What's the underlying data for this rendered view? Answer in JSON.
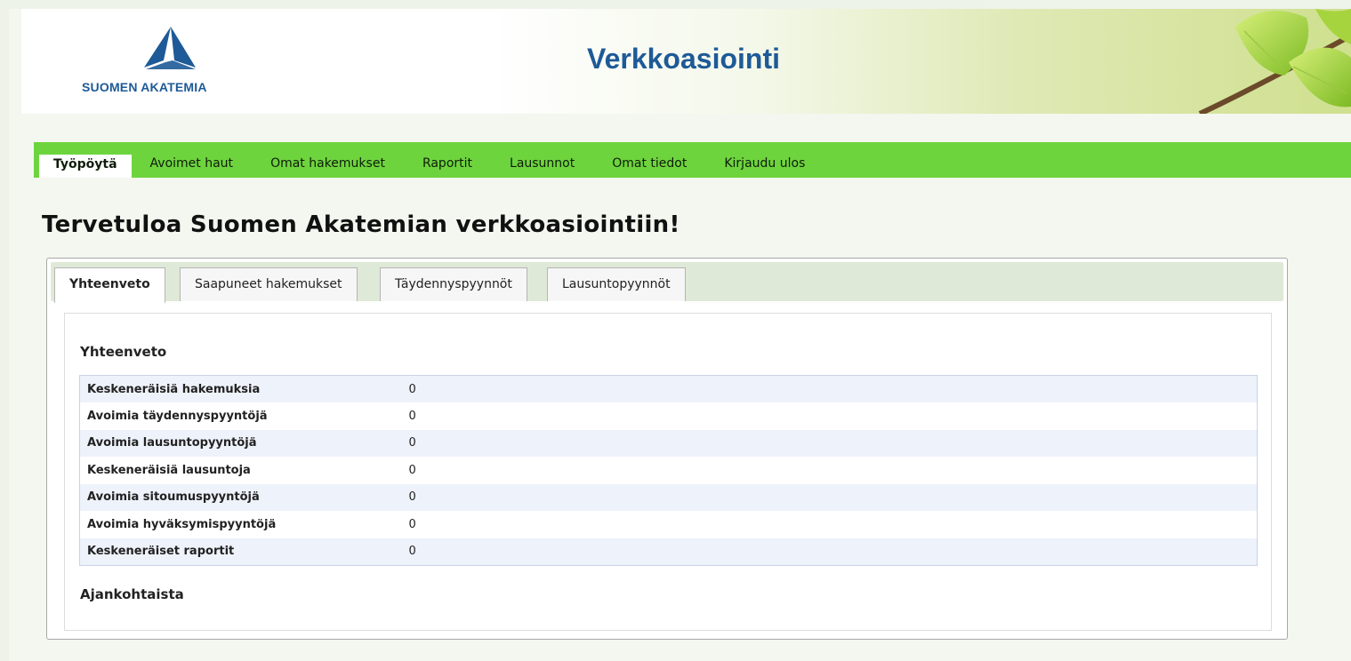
{
  "header": {
    "logo_text": "SUOMEN AKATEMIA",
    "title": "Verkkoasiointi"
  },
  "nav": {
    "items": [
      {
        "label": "Työpöytä",
        "active": true
      },
      {
        "label": "Avoimet haut"
      },
      {
        "label": "Omat hakemukset"
      },
      {
        "label": "Raportit"
      },
      {
        "label": "Lausunnot"
      },
      {
        "label": "Omat tiedot"
      },
      {
        "label": "Kirjaudu ulos"
      }
    ]
  },
  "page": {
    "heading": "Tervetuloa Suomen Akatemian verkkoasiointiin!"
  },
  "tabs": [
    {
      "label": "Yhteenveto",
      "active": true
    },
    {
      "label": "Saapuneet hakemukset"
    },
    {
      "label": "Täydennyspyynnöt"
    },
    {
      "label": "Lausuntopyynnöt"
    }
  ],
  "summary": {
    "title": "Yhteenveto",
    "rows": [
      {
        "label": "Keskeneräisiä hakemuksia",
        "value": "0"
      },
      {
        "label": "Avoimia täydennyspyyntöjä",
        "value": "0"
      },
      {
        "label": "Avoimia lausuntopyyntöjä",
        "value": "0"
      },
      {
        "label": "Keskeneräisiä lausuntoja",
        "value": "0"
      },
      {
        "label": "Avoimia sitoumuspyyntöjä",
        "value": "0"
      },
      {
        "label": "Avoimia hyväksymispyyntöjä",
        "value": "0"
      },
      {
        "label": "Keskeneräiset raportit",
        "value": "0"
      }
    ]
  },
  "news": {
    "title": "Ajankohtaista"
  },
  "colors": {
    "brand_blue": "#1d5a97",
    "nav_green": "#6ed43e",
    "tab_strip": "#dfe9d7"
  }
}
